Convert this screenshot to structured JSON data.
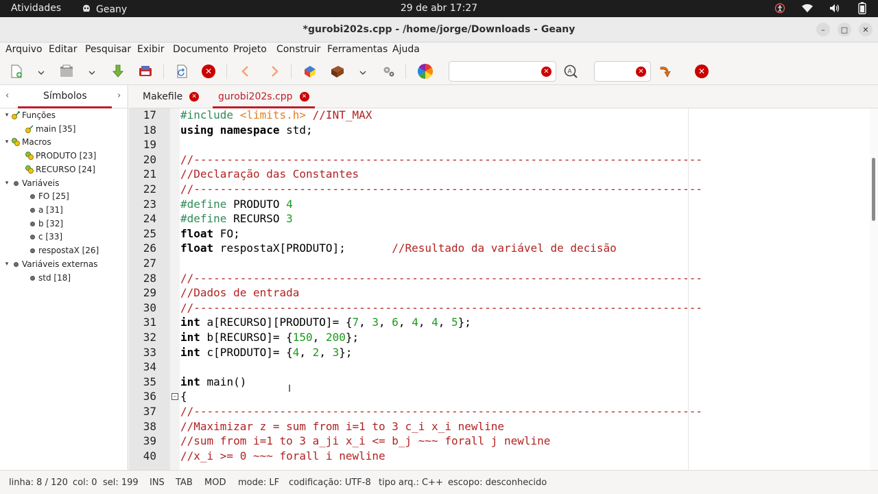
{
  "topbar": {
    "activities": "Atividades",
    "app_name": "Geany",
    "clock": "29 de abr  17:27"
  },
  "window": {
    "title": "*gurobi202s.cpp - /home/jorge/Downloads - Geany"
  },
  "menu": [
    "Arquivo",
    "Editar",
    "Pesquisar",
    "Exibir",
    "Documento",
    "Projeto",
    "Construir",
    "Ferramentas",
    "Ajuda"
  ],
  "toolbar": {
    "search_value": "",
    "goto_value": ""
  },
  "sidebar": {
    "tab_label": "Símbolos",
    "groups": [
      {
        "label": "Funções",
        "items": [
          "main [35]"
        ]
      },
      {
        "label": "Macros",
        "items": [
          "PRODUTO [23]",
          "RECURSO [24]"
        ]
      },
      {
        "label": "Variáveis",
        "items": [
          "FO [25]",
          "a [31]",
          "b [32]",
          "c [33]",
          "respostaX [26]"
        ]
      },
      {
        "label": "Variáveis externas",
        "items": [
          "std [18]"
        ]
      }
    ]
  },
  "tabs": [
    {
      "label": "Makefile",
      "active": false
    },
    {
      "label": "gurobi202s.cpp",
      "active": true
    }
  ],
  "editor": {
    "line_numbers": [
      "17",
      "18",
      "19",
      "20",
      "21",
      "22",
      "23",
      "24",
      "25",
      "26",
      "27",
      "28",
      "29",
      "30",
      "31",
      "32",
      "33",
      "34",
      "35",
      "36",
      "37",
      "38",
      "39",
      "40"
    ],
    "lines": [
      [
        [
          "pp",
          "#include "
        ],
        [
          "inc",
          "<limits.h>"
        ],
        [
          "cm",
          " //INT_MAX"
        ]
      ],
      [
        [
          "kw",
          "using namespace"
        ],
        [
          "tx",
          " std;"
        ]
      ],
      [],
      [
        [
          "cm",
          "//-----------------------------------------------------------------------------"
        ]
      ],
      [
        [
          "cm",
          "//Declaração das Constantes"
        ]
      ],
      [
        [
          "cm",
          "//-----------------------------------------------------------------------------"
        ]
      ],
      [
        [
          "pp",
          "#define"
        ],
        [
          "tx",
          " PRODUTO "
        ],
        [
          "num",
          "4"
        ]
      ],
      [
        [
          "pp",
          "#define"
        ],
        [
          "tx",
          " RECURSO "
        ],
        [
          "num",
          "3"
        ]
      ],
      [
        [
          "kw",
          "float"
        ],
        [
          "tx",
          " FO;"
        ]
      ],
      [
        [
          "kw",
          "float"
        ],
        [
          "tx",
          " respostaX[PRODUTO];       "
        ],
        [
          "cm",
          "//Resultado da variável de decisão"
        ]
      ],
      [],
      [
        [
          "cm",
          "//-----------------------------------------------------------------------------"
        ]
      ],
      [
        [
          "cm",
          "//Dados de entrada"
        ]
      ],
      [
        [
          "cm",
          "//-----------------------------------------------------------------------------"
        ]
      ],
      [
        [
          "kw",
          "int"
        ],
        [
          "tx",
          " a[RECURSO][PRODUTO]= {"
        ],
        [
          "num",
          "7"
        ],
        [
          "tx",
          ", "
        ],
        [
          "num",
          "3"
        ],
        [
          "tx",
          ", "
        ],
        [
          "num",
          "6"
        ],
        [
          "tx",
          ", "
        ],
        [
          "num",
          "4"
        ],
        [
          "tx",
          ", "
        ],
        [
          "num",
          "4"
        ],
        [
          "tx",
          ", "
        ],
        [
          "num",
          "5"
        ],
        [
          "tx",
          "};"
        ]
      ],
      [
        [
          "kw",
          "int"
        ],
        [
          "tx",
          " b[RECURSO]= {"
        ],
        [
          "num",
          "150"
        ],
        [
          "tx",
          ", "
        ],
        [
          "num",
          "200"
        ],
        [
          "tx",
          "};"
        ]
      ],
      [
        [
          "kw",
          "int"
        ],
        [
          "tx",
          " c[PRODUTO]= {"
        ],
        [
          "num",
          "4"
        ],
        [
          "tx",
          ", "
        ],
        [
          "num",
          "2"
        ],
        [
          "tx",
          ", "
        ],
        [
          "num",
          "3"
        ],
        [
          "tx",
          "};"
        ]
      ],
      [],
      [
        [
          "kw",
          "int"
        ],
        [
          "tx",
          " main()"
        ]
      ],
      [
        [
          "tx",
          "{"
        ]
      ],
      [
        [
          "cm",
          "//-----------------------------------------------------------------------------"
        ]
      ],
      [
        [
          "cm",
          "//Maximizar z = sum from i=1 to 3 c_i x_i newline"
        ]
      ],
      [
        [
          "cm",
          "//sum from i=1 to 3 a_ji x_i <= b_j ~~~ forall j newline"
        ]
      ],
      [
        [
          "cm",
          "//x_i >= 0 ~~~ forall i newline"
        ]
      ]
    ]
  },
  "status": {
    "linha": "linha: 8 / 120",
    "col": "col: 0",
    "sel": "sel: 199",
    "ins": "INS",
    "tab": "TAB",
    "mod": "MOD",
    "mode": "mode: LF",
    "encoding": "codificação: UTF-8",
    "filetype": "tipo arq.: C++",
    "scope": "escopo: desconhecido"
  },
  "colors": {
    "accent": "#c01c28",
    "preprocessor": "#2e8b57",
    "include": "#e08020",
    "comment": "#b22222",
    "number": "#1a9a1a"
  }
}
